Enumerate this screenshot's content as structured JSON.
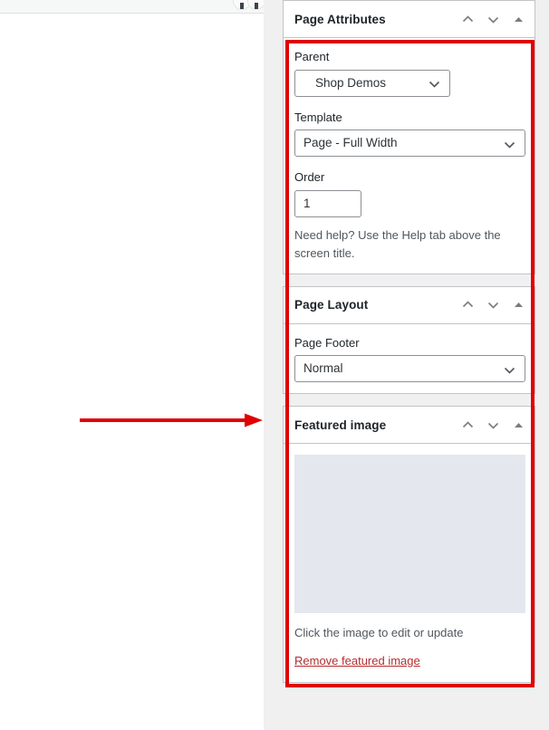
{
  "editor": {
    "toolbar_buttons": [
      {
        "name": "editor-toolbar-button-1",
        "glyph": "bar"
      },
      {
        "name": "editor-toolbar-button-2",
        "glyph": "bar"
      }
    ]
  },
  "annotation": {
    "arrow_color": "#e00000",
    "highlight_color": "#e00000",
    "arrow_name": "red-annotation-arrow",
    "highlight_name": "red-annotation-highlight-box"
  },
  "sidebar": {
    "panels": [
      {
        "id": "page-attributes",
        "title": "Page Attributes",
        "controls": {
          "move_up": "move-up-icon",
          "move_down": "move-down-icon",
          "toggle": "toggle-panel-icon"
        },
        "fields": {
          "parent_label": "Parent",
          "parent_value": "Shop Demos",
          "template_label": "Template",
          "template_value": "Page - Full Width",
          "order_label": "Order",
          "order_value": "1",
          "help_text": "Need help? Use the Help tab above the screen title."
        }
      },
      {
        "id": "page-layout",
        "title": "Page Layout",
        "controls": {
          "move_up": "move-up-icon",
          "move_down": "move-down-icon",
          "toggle": "toggle-panel-icon"
        },
        "fields": {
          "page_footer_label": "Page Footer",
          "page_footer_value": "Normal"
        }
      },
      {
        "id": "featured-image",
        "title": "Featured image",
        "controls": {
          "move_up": "move-up-icon",
          "move_down": "move-down-icon",
          "toggle": "toggle-panel-icon"
        },
        "fields": {
          "thumbnail_color": "#e4e8ee",
          "hint_text": "Click the image to edit or update",
          "remove_link": "Remove featured image"
        }
      }
    ]
  }
}
